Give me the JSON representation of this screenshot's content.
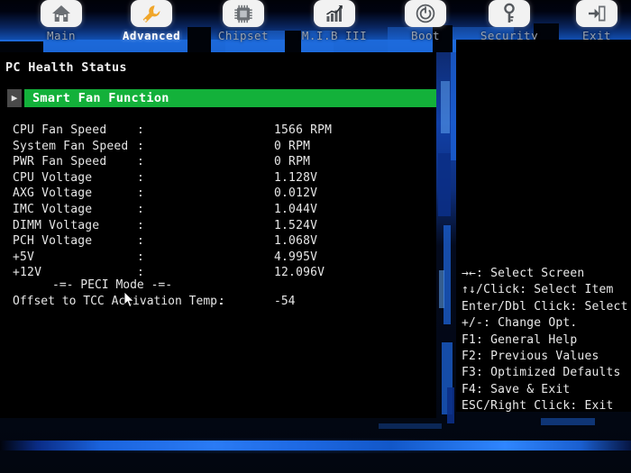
{
  "tabs": [
    {
      "label": "Main",
      "icon": "home-icon",
      "active": false
    },
    {
      "label": "Advanced",
      "icon": "wrench-icon",
      "active": true
    },
    {
      "label": "Chipset",
      "icon": "chip-icon",
      "active": false
    },
    {
      "label": "M.I.B III",
      "icon": "chart-icon",
      "active": false
    },
    {
      "label": "Boot",
      "icon": "power-icon",
      "active": false
    },
    {
      "label": "Security",
      "icon": "key-icon",
      "active": false
    },
    {
      "label": "Exit",
      "icon": "exit-icon",
      "active": false
    }
  ],
  "main": {
    "page_title": "PC Health Status",
    "selected_item": {
      "marker": "▶",
      "label": "Smart Fan Function"
    },
    "readings": [
      {
        "label": "CPU Fan Speed",
        "colon": ":",
        "value": "1566 RPM"
      },
      {
        "label": "System Fan Speed",
        "colon": ":",
        "value": "0 RPM"
      },
      {
        "label": "PWR Fan Speed",
        "colon": ":",
        "value": "0 RPM"
      },
      {
        "label": "CPU Voltage",
        "colon": ":",
        "value": "1.128V"
      },
      {
        "label": "AXG Voltage",
        "colon": ":",
        "value": "0.012V"
      },
      {
        "label": "IMC Voltage",
        "colon": ":",
        "value": "1.044V"
      },
      {
        "label": "DIMM Voltage",
        "colon": ":",
        "value": "1.524V"
      },
      {
        "label": "PCH Voltage",
        "colon": ":",
        "value": "1.068V"
      },
      {
        "label": "+5V",
        "colon": ":",
        "value": "4.995V"
      },
      {
        "label": "+12V",
        "colon": ":",
        "value": "12.096V"
      }
    ],
    "peci": {
      "heading": "-=- PECI Mode -=-",
      "row": {
        "label": "Offset to TCC Activation Temp.",
        "colon": ":",
        "value": "-54"
      }
    }
  },
  "help": {
    "lines": [
      "→←: Select Screen",
      "↑↓/Click: Select Item",
      "Enter/Dbl Click: Select",
      "+/-: Change Opt.",
      "F1: General Help",
      "F2: Previous Values",
      "F3: Optimized Defaults",
      "F4: Save & Exit",
      "ESC/Right Click: Exit"
    ]
  },
  "colors": {
    "selection_green": "#13b13a",
    "accent_blue": "#2a7bf5",
    "panel_black": "#000000",
    "text": "#e6e6e6",
    "inactive_tab_text": "#9aa2ae",
    "wrench_orange": "#f0a62a"
  }
}
